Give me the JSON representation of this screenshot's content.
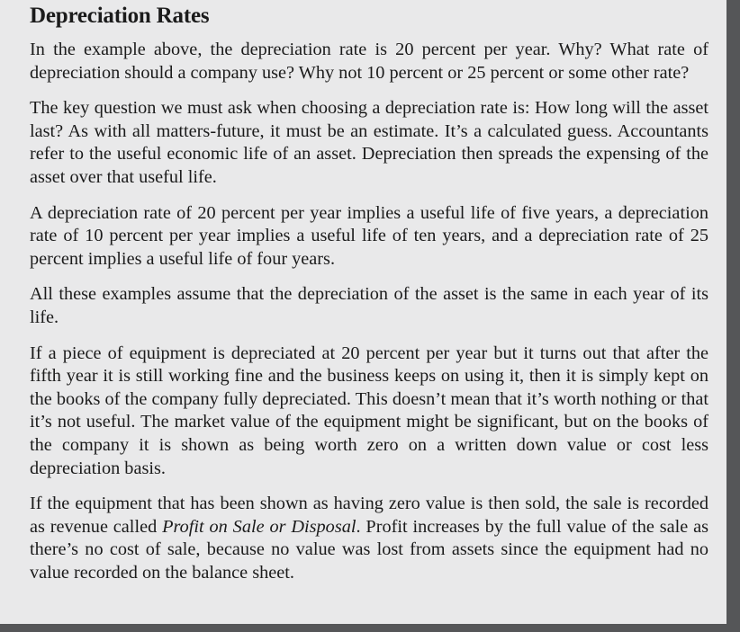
{
  "section": {
    "title": "Depreciation Rates",
    "paragraphs": [
      "In the example above, the depreciation rate is 20 percent per year. Why? What rate of depreciation should a company use? Why not 10 percent or 25 percent or some other rate?",
      "The key question we must ask when choosing a depreciation rate is: How long will the asset last? As with all matters-future, it must be an estimate. It’s a calculated guess. Accountants refer to the useful economic life of an asset. Depreciation then spreads the expensing of the asset over that useful life.",
      "A depreciation rate of 20 percent per year implies a useful life of five years, a depreciation rate of 10 percent per year implies a useful life of ten years, and a depreciation rate of 25 percent implies a useful life of four years.",
      "All these examples assume that the depreciation of the asset is the same in each year of its life.",
      "If a piece of equipment is depreciated at 20 percent per year but it turns out that after the fifth year it is still working fine and the business keeps on using it, then it is simply kept on the books of the company fully depreciated. This doesn’t mean that it’s worth nothing or that it’s not useful. The market value of the equipment might be significant, but on the books of the company it is shown as being worth zero on a written down value or cost less depreciation basis."
    ],
    "last_paragraph": {
      "before": "If the equipment that has been shown as having zero value is then sold, the sale is recorded as revenue called ",
      "emphasis": "Profit on Sale or Disposal",
      "after": ". Profit increases by the full value of the sale as there’s no cost of sale, because no value was lost from assets since the equipment had no value recorded on the balance sheet."
    }
  }
}
